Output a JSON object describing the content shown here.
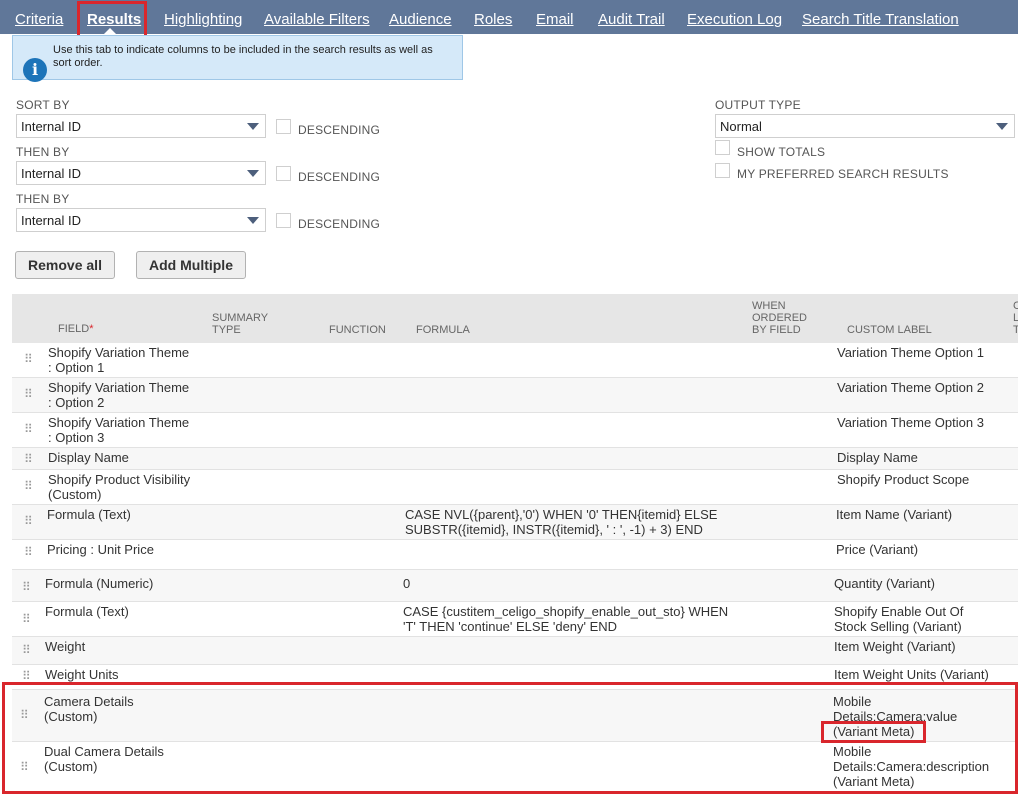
{
  "tabs": [
    "Criteria",
    "Results",
    "Highlighting",
    "Available Filters",
    "Audience",
    "Roles",
    "Email",
    "Audit Trail",
    "Execution Log",
    "Search Title Translation"
  ],
  "info": {
    "text": "Use this tab to indicate columns to be included in the search results as well as sort order."
  },
  "sort": {
    "sort_by_label": "SORT BY",
    "then_by_label": "THEN BY",
    "selects": [
      "Internal ID",
      "Internal ID",
      "Internal ID"
    ],
    "descending_label": "DESCENDING"
  },
  "output": {
    "label": "OUTPUT TYPE",
    "value": "Normal",
    "show_totals": "SHOW TOTALS",
    "preferred": "MY PREFERRED SEARCH RESULTS"
  },
  "buttons": {
    "remove_all": "Remove all",
    "add_multiple": "Add Multiple"
  },
  "grid": {
    "headers": {
      "field": "FIELD",
      "summary_type_1": "SUMMARY",
      "summary_type_2": "TYPE",
      "function": "FUNCTION",
      "formula": "FORMULA",
      "when_1": "WHEN",
      "when_2": "ORDERED",
      "when_3": "BY FIELD",
      "custom_label": "CUSTOM LABEL",
      "cut_1": "C",
      "cut_2": "L",
      "cut_3": "T"
    },
    "rows": [
      {
        "field1": "Shopify Variation Theme",
        "field2": ": Option 1",
        "formula1": "",
        "formula2": "",
        "label1": "Variation Theme Option 1",
        "label2": "",
        "label3": ""
      },
      {
        "field1": "Shopify Variation Theme",
        "field2": ": Option 2",
        "formula1": "",
        "formula2": "",
        "label1": "Variation Theme Option 2",
        "label2": "",
        "label3": ""
      },
      {
        "field1": "Shopify Variation Theme",
        "field2": ": Option 3",
        "formula1": "",
        "formula2": "",
        "label1": "Variation Theme Option 3",
        "label2": "",
        "label3": ""
      },
      {
        "field1": "Display Name",
        "field2": "",
        "formula1": "",
        "formula2": "",
        "label1": "Display Name",
        "label2": "",
        "label3": ""
      },
      {
        "field1": "Shopify Product Visibility",
        "field2": "(Custom)",
        "formula1": "",
        "formula2": "",
        "label1": "Shopify Product Scope",
        "label2": "",
        "label3": ""
      },
      {
        "field1": "Formula (Text)",
        "field2": "",
        "formula1": "CASE NVL({parent},'0') WHEN '0' THEN{itemid} ELSE",
        "formula2": "SUBSTR({itemid}, INSTR({itemid}, ' : ', -1) + 3) END",
        "label1": "Item Name (Variant)",
        "label2": "",
        "label3": ""
      },
      {
        "field1": "Pricing : Unit Price",
        "field2": "",
        "formula1": "",
        "formula2": "",
        "label1": "Price (Variant)",
        "label2": "",
        "label3": ""
      },
      {
        "field1": "Formula (Numeric)",
        "field2": "",
        "formula1": "0",
        "formula2": "",
        "label1": "Quantity (Variant)",
        "label2": "",
        "label3": ""
      },
      {
        "field1": "Formula (Text)",
        "field2": "",
        "formula1": "CASE {custitem_celigo_shopify_enable_out_sto} WHEN",
        "formula2": "'T' THEN 'continue' ELSE 'deny' END",
        "label1": "Shopify Enable Out Of",
        "label2": "Stock Selling (Variant)",
        "label3": ""
      },
      {
        "field1": "Weight",
        "field2": "",
        "formula1": "",
        "formula2": "",
        "label1": "Item Weight (Variant)",
        "label2": "",
        "label3": ""
      },
      {
        "field1": "Weight Units",
        "field2": "",
        "formula1": "",
        "formula2": "",
        "label1": "Item Weight Units (Variant)",
        "label2": "",
        "label3": ""
      },
      {
        "field1": "Camera Details",
        "field2": "(Custom)",
        "formula1": "",
        "formula2": "",
        "label1": "Mobile",
        "label2": "Details:Camera:value",
        "label3": "(Variant Meta)"
      },
      {
        "field1": "Dual Camera Details",
        "field2": "(Custom)",
        "formula1": "",
        "formula2": "",
        "label1": "Mobile",
        "label2": "Details:Camera:description",
        "label3": "(Variant Meta)"
      }
    ]
  },
  "colors": {
    "tabbar": "#607799",
    "highlight": "#d9262c",
    "info_bg": "#d5e9f9",
    "header_bg": "#e6e6e6"
  }
}
